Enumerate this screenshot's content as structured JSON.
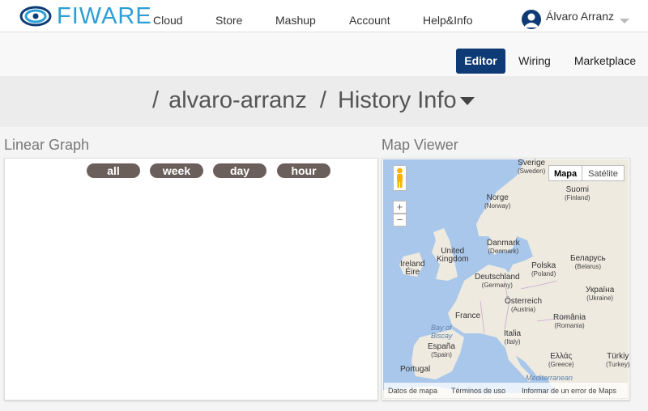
{
  "header": {
    "logo_text": "FIWARE",
    "nav": [
      "Cloud",
      "Store",
      "Mashup",
      "Account",
      "Help&Info"
    ],
    "user_name": "Álvaro Arranz"
  },
  "modes": [
    {
      "label": "Editor",
      "active": true
    },
    {
      "label": "Wiring",
      "active": false
    },
    {
      "label": "Marketplace",
      "active": false
    }
  ],
  "breadcrumb": {
    "user": "alvaro-arranz",
    "workspace": "History Info"
  },
  "linear_graph": {
    "title": "Linear Graph",
    "ranges": [
      "all",
      "week",
      "day",
      "hour"
    ]
  },
  "map_viewer": {
    "title": "Map Viewer",
    "map_type_options": [
      "Mapa",
      "Satélite"
    ],
    "selected_map_type": "Mapa",
    "zoom_in": "+",
    "zoom_out": "−",
    "labels": [
      {
        "name": "Sverige",
        "sub": "(Sweden)"
      },
      {
        "name": "Suomi",
        "sub": "(Finland)"
      },
      {
        "name": "Norge",
        "sub": "(Norway)"
      },
      {
        "name": "Danmark",
        "sub": "(Denmark)"
      },
      {
        "name": "United",
        "sub": "Kingdom"
      },
      {
        "name": "Ireland",
        "sub": "Éire"
      },
      {
        "name": "Беларусь",
        "sub": "(Belarus)"
      },
      {
        "name": "Polska",
        "sub": "(Poland)"
      },
      {
        "name": "Deutschland",
        "sub": "(Germany)"
      },
      {
        "name": "Україна",
        "sub": "(Ukraine)"
      },
      {
        "name": "Österreich",
        "sub": "(Austria)"
      },
      {
        "name": "France",
        "sub": ""
      },
      {
        "name": "România",
        "sub": "(Romania)"
      },
      {
        "name": "Italia",
        "sub": "(Italy)"
      },
      {
        "name": "España",
        "sub": "(Spain)"
      },
      {
        "name": "Ελλάς",
        "sub": "(Greece)"
      },
      {
        "name": "Türkiy",
        "sub": "(Turkey)"
      },
      {
        "name": "Portugal",
        "sub": ""
      }
    ],
    "seas": [
      "Bay of",
      "Biscay",
      "Mediterranean"
    ],
    "footer": [
      "Datos de mapa",
      "Términos de uso",
      "Informar de un error de Maps"
    ]
  },
  "colors": {
    "accent": "#0e3b75",
    "logo": "#2b9fd6",
    "pill": "#6b5f5b",
    "sea": "#a9c7ea",
    "land": "#eeeae0"
  }
}
